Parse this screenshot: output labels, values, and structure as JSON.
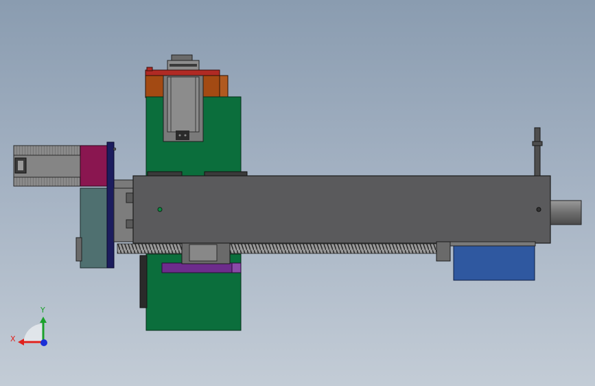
{
  "triad": {
    "x_label": "X",
    "y_label": "Y",
    "x_color": "#e0201c",
    "y_color": "#1aa12a",
    "z_color": "#1b2fd6"
  },
  "colors": {
    "background_top": "#8a9cb0",
    "background_bottom": "#c3ccd6",
    "frame_gray": "#5a5a5c",
    "green_plate": "#0b6e3c",
    "orange_block": "#a34a13",
    "motor_gray": "#7d7d7d",
    "magenta_adapter": "#8a1650",
    "navy_plate": "#1c1d5e",
    "teal_housing": "#4f7070",
    "purple_bar": "#6d2c8c",
    "blue_block": "#2f58a0"
  }
}
